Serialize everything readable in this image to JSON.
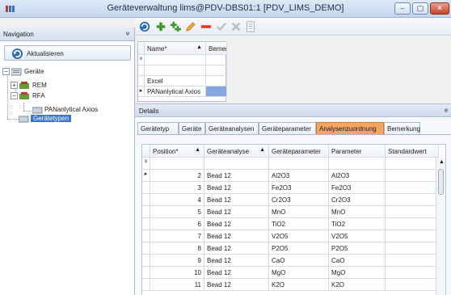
{
  "window": {
    "title": "Geräteverwaltung lims@PDV-DBS01:1 [PDV_LIMS_DEMO]",
    "minimize": "–",
    "maximize": "▢",
    "close": "✕"
  },
  "navigation": {
    "header": "Navigation",
    "pin": "ᵠ",
    "refresh_label": "Aktualisieren",
    "tree": [
      {
        "label": "Geräte"
      },
      {
        "label": "REM"
      },
      {
        "label": "RFA"
      },
      {
        "label": "PANanlytical Axios"
      },
      {
        "label": "Gerätetypen"
      }
    ]
  },
  "toolbar": {
    "icons": [
      "refresh-icon",
      "add-icon",
      "add-multiple-icon",
      "edit-icon",
      "remove-icon",
      "confirm-icon",
      "cancel-icon",
      "document-icon"
    ]
  },
  "top_grid": {
    "columns": [
      "Name*",
      "Bemerkung"
    ],
    "filter_marker": "ᵠ",
    "rows": [
      {
        "name": "Excel",
        "remark": ""
      },
      {
        "name": "PANanlytical Axios",
        "remark": ""
      }
    ]
  },
  "details": {
    "header": "Details",
    "pin": "ᵠ",
    "tabs": [
      "Gerätetyp",
      "Geräte",
      "Geräteanalysen",
      "Geräteparameter",
      "Analysenzuordnung",
      "Bemerkung"
    ],
    "active_tab": "Analysenzuordnung",
    "grid": {
      "columns": [
        "Position*",
        "Geräteanalyse",
        "Geräteparameter",
        "Parameter",
        "Standardwert"
      ],
      "filter_marker": "ᵠ",
      "rows": [
        {
          "position": "2",
          "analysis": "Bead 12",
          "device_param": "Al2O3",
          "param": "Al2O3",
          "default": ""
        },
        {
          "position": "3",
          "analysis": "Bead 12",
          "device_param": "Fe2O3",
          "param": "Fe2O3",
          "default": ""
        },
        {
          "position": "4",
          "analysis": "Bead 12",
          "device_param": "Cr2O3",
          "param": "Cr2O3",
          "default": ""
        },
        {
          "position": "5",
          "analysis": "Bead 12",
          "device_param": "MnO",
          "param": "MnO",
          "default": ""
        },
        {
          "position": "6",
          "analysis": "Bead 12",
          "device_param": "TiO2",
          "param": "TiO2",
          "default": ""
        },
        {
          "position": "7",
          "analysis": "Bead 12",
          "device_param": "V2O5",
          "param": "V2O5",
          "default": ""
        },
        {
          "position": "8",
          "analysis": "Bead 12",
          "device_param": "P2O5",
          "param": "P2O5",
          "default": ""
        },
        {
          "position": "9",
          "analysis": "Bead 12",
          "device_param": "CaO",
          "param": "CaO",
          "default": ""
        },
        {
          "position": "10",
          "analysis": "Bead 12",
          "device_param": "MgO",
          "param": "MgO",
          "default": ""
        },
        {
          "position": "11",
          "analysis": "Bead 12",
          "device_param": "K2O",
          "param": "K2O",
          "default": ""
        }
      ]
    }
  }
}
